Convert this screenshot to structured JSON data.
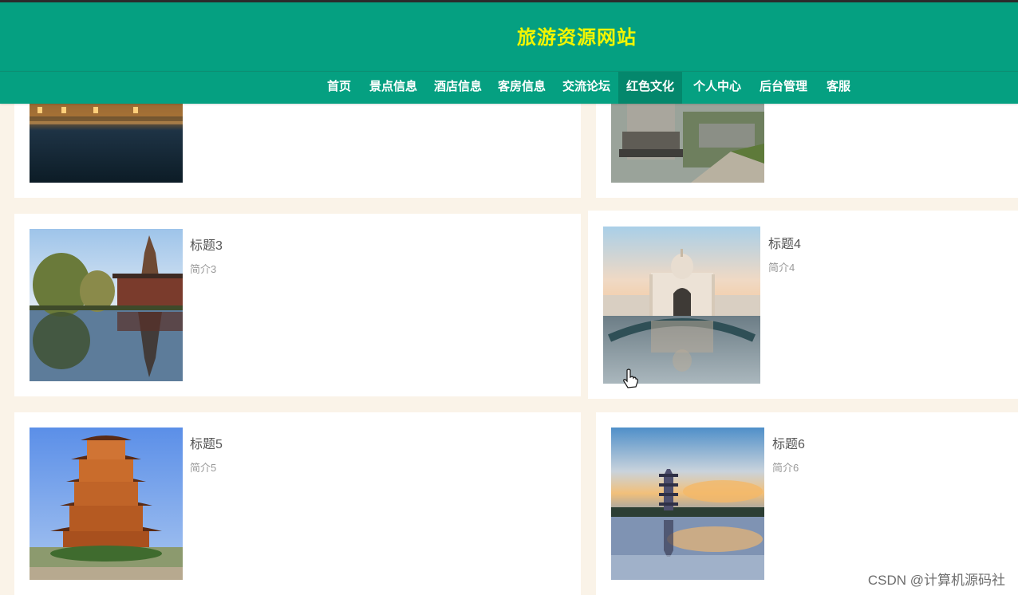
{
  "site": {
    "title": "旅游资源网站"
  },
  "nav": {
    "items": [
      {
        "label": "首页"
      },
      {
        "label": "景点信息"
      },
      {
        "label": "酒店信息"
      },
      {
        "label": "客房信息"
      },
      {
        "label": "交流论坛"
      },
      {
        "label": "红色文化",
        "active": true
      },
      {
        "label": "个人中心"
      },
      {
        "label": "后台管理"
      },
      {
        "label": "客服"
      }
    ]
  },
  "cards": [
    {
      "title": "",
      "desc": ""
    },
    {
      "title": "",
      "desc": ""
    },
    {
      "title": "标题3",
      "desc": "简介3"
    },
    {
      "title": "标题4",
      "desc": "简介4"
    },
    {
      "title": "标题5",
      "desc": "简介5"
    },
    {
      "title": "标题6",
      "desc": "简介6"
    }
  ],
  "watermark": "CSDN @计算机源码社",
  "colors": {
    "header": "#05a081",
    "title": "#f3f500",
    "active_nav": "#04876c"
  }
}
